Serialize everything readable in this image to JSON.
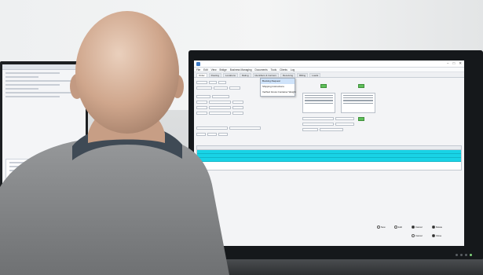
{
  "scene": {
    "colors": {
      "wall": "#e6e8ea",
      "monitor_bezel": "#15181b",
      "row_highlight": "#19d3e6",
      "skin": "#d8b8a2",
      "sweater": "#8c8e90",
      "collar": "#3f4a55"
    }
  },
  "app": {
    "menus": [
      "File",
      "Edit",
      "View",
      "Bridge",
      "Business Managing",
      "Documents",
      "Tools",
      "Clients",
      "Log"
    ],
    "tabs": [
      "Order",
      "Routing",
      "Locations",
      "Rating",
      "Identifiers & Carriers",
      "Receiving",
      "Billing",
      "Loads"
    ],
    "dropdown_items": [
      "Booking Request",
      "Shipping Instructions",
      "Verified Gross Container Weight"
    ],
    "radio_options": [
      "New",
      "Edit",
      "Cancel",
      "Delete",
      "Cancel",
      "Close"
    ],
    "grid_rows": 3,
    "window_controls": [
      "–",
      "□",
      "✕"
    ]
  }
}
